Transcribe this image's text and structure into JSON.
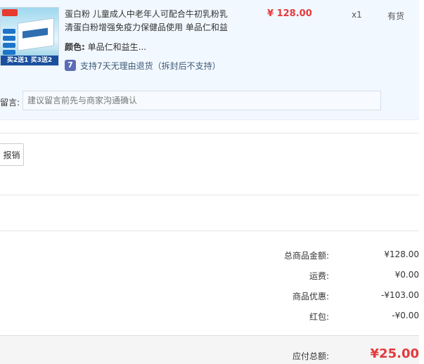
{
  "product": {
    "title": "蛋白粉 儿童成人中老年人可配合牛初乳粉乳清蛋白粉增强免疫力保健品使用 单品仁和益",
    "promo_banner": "买2送1 买3送2",
    "color_label": "颜色:",
    "color_value": "单品仁和益生...",
    "return_icon_text": "7",
    "return_policy": "支持7天无理由退货（拆封后不支持）",
    "price": "¥ 128.00",
    "quantity": "x1",
    "stock_status": "有货"
  },
  "note": {
    "label": "留言:",
    "placeholder": "建议留言前先与商家沟通确认"
  },
  "invoice": {
    "button_label": "报销"
  },
  "summary": [
    {
      "label": "总商品金额:",
      "value": "¥128.00"
    },
    {
      "label": "运费:",
      "value": "¥0.00"
    },
    {
      "label": "商品优惠:",
      "value": "-¥103.00"
    },
    {
      "label": "红包:",
      "value": "-¥0.00"
    }
  ],
  "total": {
    "label": "应付总额:",
    "value": "¥25.00"
  },
  "colors": {
    "price_red": "#e4393c",
    "panel_bg": "#f2f8ff"
  }
}
